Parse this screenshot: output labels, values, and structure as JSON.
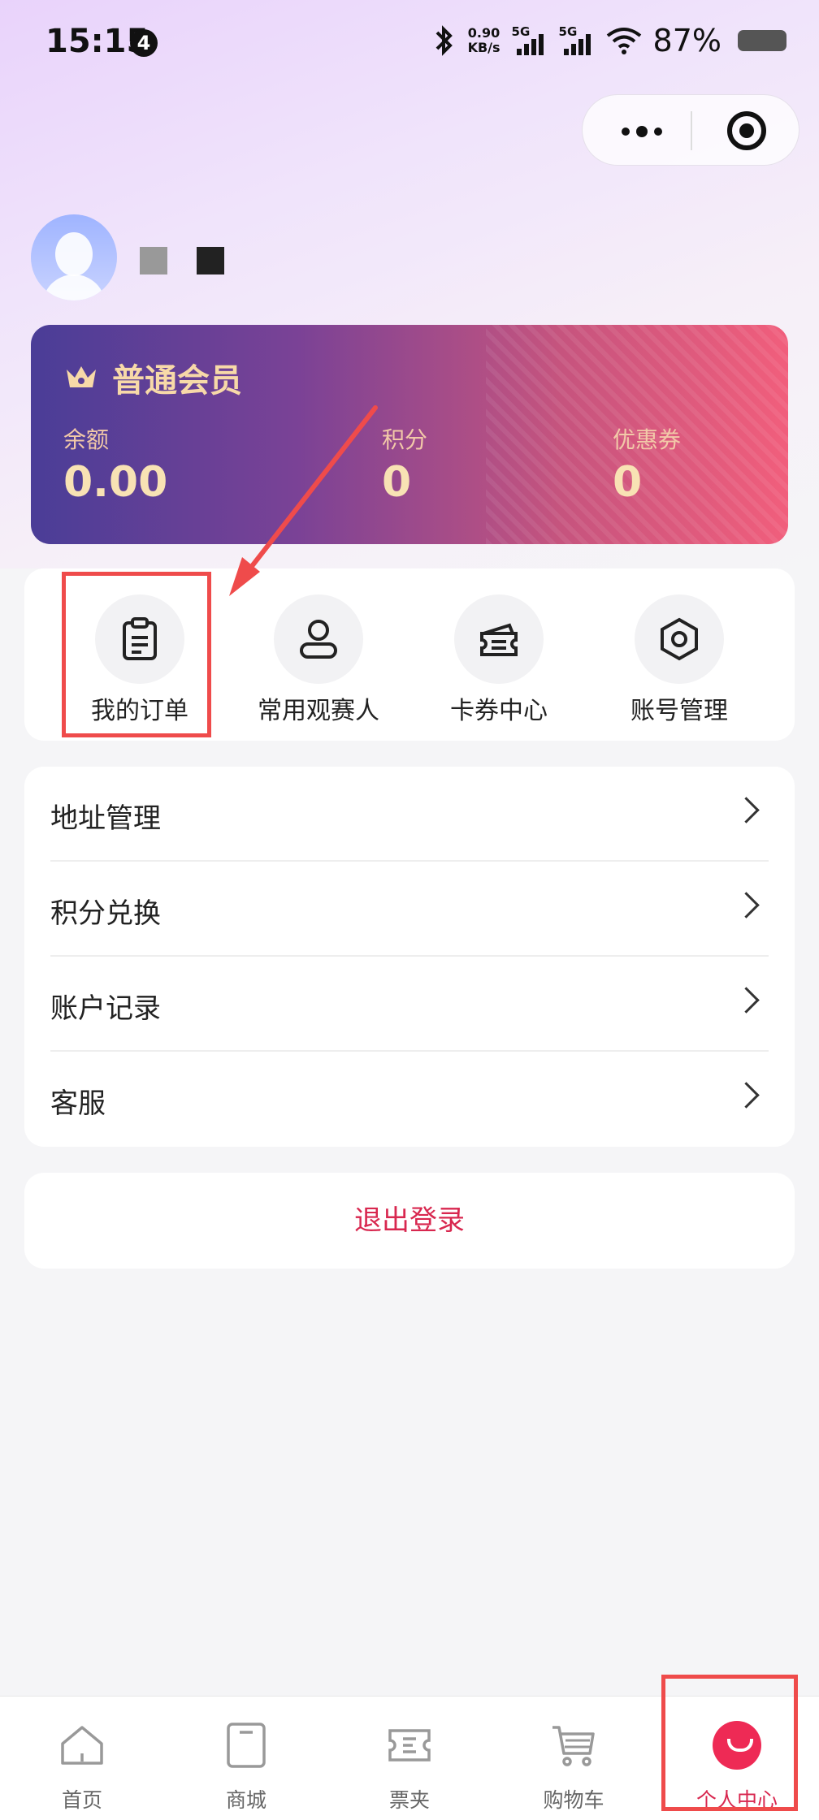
{
  "status_bar": {
    "time": "15:15",
    "notification_count": "4",
    "net_speed_value": "0.90",
    "net_speed_unit": "KB/s",
    "sim1_label": "5G",
    "sim2_label": "5G",
    "battery_percent": "87%"
  },
  "member_card": {
    "level": "普通会员",
    "stats": [
      {
        "label": "余额",
        "value": "0.00"
      },
      {
        "label": "积分",
        "value": "0"
      },
      {
        "label": "优惠券",
        "value": "0"
      }
    ]
  },
  "quick_actions": [
    {
      "label": "我的订单",
      "icon": "clipboard-icon"
    },
    {
      "label": "常用观赛人",
      "icon": "person-icon"
    },
    {
      "label": "卡券中心",
      "icon": "ticket-card-icon"
    },
    {
      "label": "账号管理",
      "icon": "hexagon-settings-icon"
    }
  ],
  "menu": [
    {
      "label": "地址管理"
    },
    {
      "label": "积分兑换"
    },
    {
      "label": "账户记录"
    },
    {
      "label": "客服"
    }
  ],
  "logout_label": "退出登录",
  "tabbar": [
    {
      "label": "首页",
      "icon": "home-icon"
    },
    {
      "label": "商城",
      "icon": "shopping-bag-icon"
    },
    {
      "label": "票夹",
      "icon": "ticket-icon"
    },
    {
      "label": "购物车",
      "icon": "cart-icon"
    },
    {
      "label": "个人中心",
      "icon": "profile-icon",
      "active": true
    }
  ],
  "colors": {
    "accent": "#d8274f",
    "annotation_red": "#ef4b4b",
    "card_gold": "#f7d9a8"
  }
}
